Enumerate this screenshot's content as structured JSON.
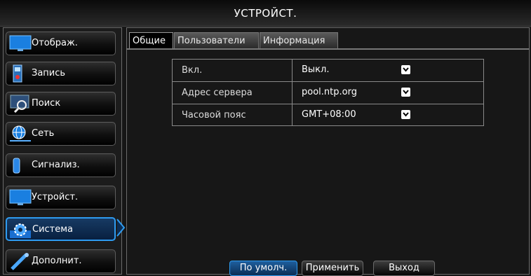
{
  "window": {
    "title": "УСТРОЙСТ."
  },
  "sidebar": {
    "items": [
      {
        "label": "Отображ.",
        "icon": "monitor-icon"
      },
      {
        "label": "Запись",
        "icon": "record-icon"
      },
      {
        "label": "Поиск",
        "icon": "search-icon"
      },
      {
        "label": "Сеть",
        "icon": "network-icon"
      },
      {
        "label": "Сигнализ.",
        "icon": "alarm-icon"
      },
      {
        "label": "Устройст.",
        "icon": "device-icon"
      },
      {
        "label": "Система",
        "icon": "gear-icon",
        "active": true
      },
      {
        "label": "Дополнит.",
        "icon": "wrench-icon"
      }
    ]
  },
  "tabs": [
    {
      "label": "Общие",
      "active": true
    },
    {
      "label": "Пользователи"
    },
    {
      "label": "Информация"
    }
  ],
  "form": {
    "rows": [
      {
        "label": "Вкл.",
        "value": "Выкл."
      },
      {
        "label": "Адрес сервера",
        "value": "pool.ntp.org"
      },
      {
        "label": "Часовой пояс",
        "value": "GMT+08:00"
      }
    ]
  },
  "buttons": {
    "default_label": "По умолч.",
    "apply_label": "Применить",
    "exit_label": "Выход"
  },
  "colors": {
    "accent": "#2e9bf0",
    "background": "#161616"
  }
}
